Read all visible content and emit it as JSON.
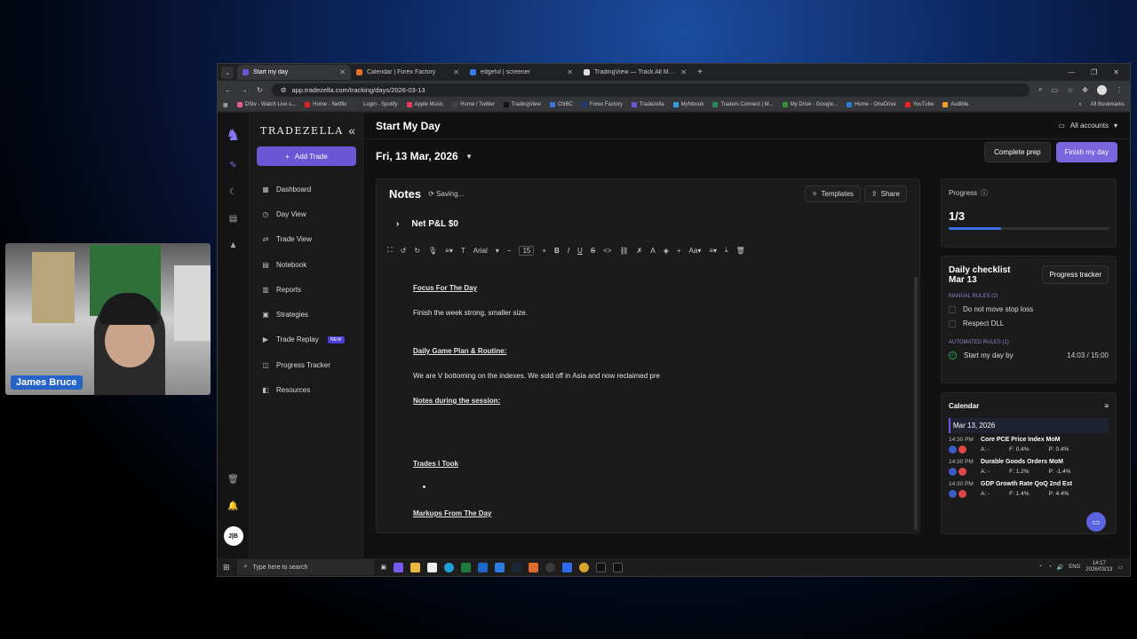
{
  "browser": {
    "tabs": [
      {
        "title": "Start my day",
        "color": "#6b57d6",
        "active": true
      },
      {
        "title": "Calendar | Forex Factory",
        "color": "#e76f2c",
        "active": false
      },
      {
        "title": "edgeful | screener",
        "color": "#3a7bf0",
        "active": false
      },
      {
        "title": "TradingView — Track All Markets",
        "color": "#dddddd",
        "active": false
      }
    ],
    "url": "app.tradezella.com/tracking/days/2026-03-13",
    "bookmarks": [
      "DStv - Watch Live s...",
      "Home - Netflix",
      "Login - Spotify",
      "Apple Music",
      "Home / Twitter",
      "TradingView",
      "CNBC",
      "Forex Factory",
      "Tradezella",
      "Myfxbook",
      "Traders Connect | M...",
      "My Drive - Google...",
      "Home - OneDrive",
      "YouTube",
      "Audible"
    ],
    "all_bookmarks": "All Bookmarks"
  },
  "sidebar": {
    "brand": "TRADEZELLA",
    "add_trade": "Add Trade",
    "items": [
      {
        "label": "Dashboard",
        "icon": "dashboard-icon",
        "glyph": "▦"
      },
      {
        "label": "Day View",
        "icon": "calendar-icon",
        "glyph": "◷"
      },
      {
        "label": "Trade View",
        "icon": "trade-icon",
        "glyph": "⇄"
      },
      {
        "label": "Notebook",
        "icon": "notebook-icon",
        "glyph": "▤"
      },
      {
        "label": "Reports",
        "icon": "reports-icon",
        "glyph": "▥"
      },
      {
        "label": "Strategies",
        "icon": "strategies-icon",
        "glyph": "▣"
      },
      {
        "label": "Trade Replay",
        "icon": "play-icon",
        "glyph": "▶",
        "badge": "NEW"
      },
      {
        "label": "Progress Tracker",
        "icon": "progress-icon",
        "glyph": "◫"
      },
      {
        "label": "Resources",
        "icon": "resources-icon",
        "glyph": "◧"
      }
    ],
    "avatar": "J|B"
  },
  "header": {
    "title": "Start My Day",
    "accounts": "All accounts"
  },
  "date": "Fri, 13 Mar, 2026",
  "actions": {
    "complete_prep": "Complete prep",
    "finish_day": "Finish my day"
  },
  "notes": {
    "title": "Notes",
    "status": "Saving...",
    "templates": "Templates",
    "share": "Share",
    "net_pnl": "Net P&L $0",
    "toolbar": {
      "font": "Arial",
      "size": "15"
    },
    "content": {
      "h1": "Focus For The Day",
      "p1": "Finish the week strong, smaller size.",
      "h2": "Daily Game Plan & Routine:",
      "p2": "We are V bottoming on the indexes. We sold off in Asia and now reclaimed pre",
      "h3": "Notes during the session:",
      "h4": "Trades I Took",
      "h5": "Markups From The Day"
    }
  },
  "progress": {
    "label": "Progress",
    "value": "1/3",
    "fraction": 0.33
  },
  "checklist": {
    "title": "Daily checklist",
    "date": "Mar 13",
    "tracker_button": "Progress tracker",
    "manual_label": "MANUAL RULES (2)",
    "manual_rules": [
      "Do not move stop loss",
      "Respect DLL"
    ],
    "automated_label": "AUTOMATED RULES (1)",
    "automated_rule": "Start my day by",
    "automated_time": "14:03 / 15:00"
  },
  "calendar": {
    "title": "Calendar",
    "date": "Mar 13, 2026",
    "events": [
      {
        "time": "14:30 PM",
        "name": "Core PCE Price Index MoM",
        "a": "A: -",
        "f": "F: 0.4%",
        "p": "P: 0.4%"
      },
      {
        "time": "14:30 PM",
        "name": "Durable Goods Orders MoM",
        "a": "A: -",
        "f": "F: 1.2%",
        "p": "P: -1.4%"
      },
      {
        "time": "14:30 PM",
        "name": "GDP Growth Rate QoQ 2nd Est",
        "a": "A: -",
        "f": "F: 1.4%",
        "p": "P: 4.4%"
      }
    ]
  },
  "taskbar": {
    "search": "Type here to search",
    "lang": "ENG",
    "time": "14:17",
    "date": "2026/03/13"
  },
  "webcam": {
    "name": "James Bruce"
  }
}
